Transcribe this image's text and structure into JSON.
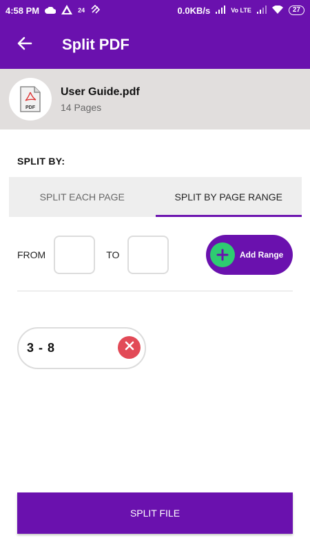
{
  "status": {
    "time": "4:58 PM",
    "notif_count": "24",
    "net_speed": "0.0KB/s",
    "volte": "Vo LTE",
    "battery": "27"
  },
  "header": {
    "title": "Split PDF",
    "back_icon": "arrow-left-icon"
  },
  "file": {
    "name": "User Guide.pdf",
    "pages": "14 Pages",
    "icon_label": "PDF"
  },
  "split_by": {
    "label": "SPLIT BY:",
    "tabs": [
      {
        "label": "SPLIT EACH PAGE",
        "active": false
      },
      {
        "label": "SPLIT BY PAGE RANGE",
        "active": true
      }
    ]
  },
  "range_form": {
    "from_label": "FROM",
    "to_label": "TO",
    "from_value": "",
    "to_value": "",
    "add_button": "Add Range"
  },
  "ranges": [
    {
      "label": "3  -  8"
    }
  ],
  "actions": {
    "split_button": "SPLIT FILE"
  },
  "colors": {
    "primary": "#6a11ae",
    "add_icon": "#2ecc71",
    "remove_icon": "#e24a57",
    "file_bar": "#e1dedd"
  }
}
